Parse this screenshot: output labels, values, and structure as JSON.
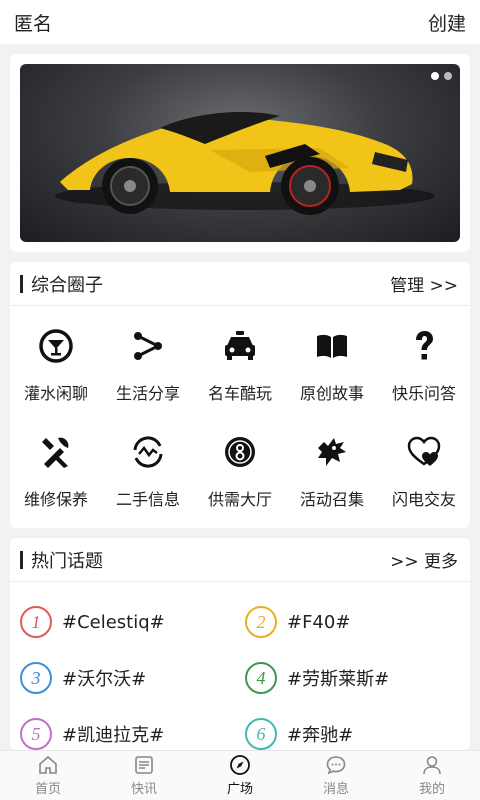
{
  "header": {
    "title": "匿名",
    "action": "创建"
  },
  "banner": {
    "slides": 2,
    "active_slide": 1
  },
  "circles": {
    "title": "综合圈子",
    "more": "管理 >>",
    "items": [
      {
        "label": "灌水闲聊",
        "icon": "cocktail-icon"
      },
      {
        "label": "生活分享",
        "icon": "share-icon"
      },
      {
        "label": "名车酷玩",
        "icon": "taxi-icon"
      },
      {
        "label": "原创故事",
        "icon": "book-icon"
      },
      {
        "label": "快乐问答",
        "icon": "question-icon"
      },
      {
        "label": "维修保养",
        "icon": "tools-icon"
      },
      {
        "label": "二手信息",
        "icon": "recycle-icon"
      },
      {
        "label": "供需大厅",
        "icon": "hall-icon"
      },
      {
        "label": "活动召集",
        "icon": "dragon-icon"
      },
      {
        "label": "闪电交友",
        "icon": "heart-icon"
      }
    ]
  },
  "topics": {
    "title": "热门话题",
    "more": ">> 更多",
    "items": [
      {
        "rank": "1",
        "text": "#Celestiq#",
        "color": "#e05a5a"
      },
      {
        "rank": "2",
        "text": "#F40#",
        "color": "#e8b020"
      },
      {
        "rank": "3",
        "text": "#沃尔沃#",
        "color": "#3a8fd8"
      },
      {
        "rank": "4",
        "text": "#劳斯莱斯#",
        "color": "#3a9a4a"
      },
      {
        "rank": "5",
        "text": "#凯迪拉克#",
        "color": "#c070c8"
      },
      {
        "rank": "6",
        "text": "#奔驰#",
        "color": "#40b8b0"
      }
    ]
  },
  "tabs": [
    {
      "label": "首页",
      "icon": "home-icon",
      "active": false
    },
    {
      "label": "快讯",
      "icon": "news-icon",
      "active": false
    },
    {
      "label": "广场",
      "icon": "compass-icon",
      "active": true
    },
    {
      "label": "消息",
      "icon": "message-icon",
      "active": false
    },
    {
      "label": "我的",
      "icon": "user-icon",
      "active": false
    }
  ]
}
